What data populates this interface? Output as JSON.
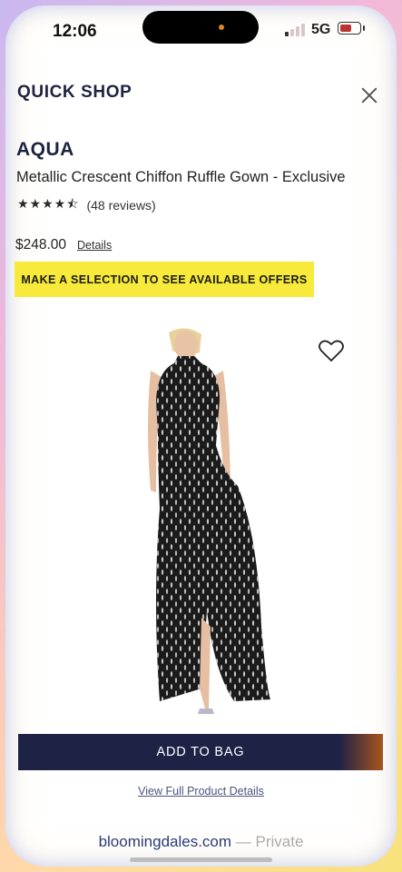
{
  "status_bar": {
    "time": "12:06",
    "network": "5G"
  },
  "header": {
    "title": "QUICK SHOP"
  },
  "product": {
    "brand": "AQUA",
    "name": "Metallic Crescent Chiffon Ruffle Gown - Exclusive",
    "rating": 4.5,
    "stars": "★★★★⯪",
    "reviews": "(48 reviews)",
    "price": "$248.00",
    "details_link": "Details"
  },
  "offer_banner": "MAKE A SELECTION TO SEE AVAILABLE OFFERS",
  "actions": {
    "add_to_bag": "ADD TO BAG",
    "view_full": "View Full Product Details"
  },
  "browser": {
    "domain": "bloomingdales.com",
    "private": "— Private"
  },
  "colors": {
    "navy": "#1e2245",
    "banner_yellow": "#f7ea3a",
    "brand_navy": "#1d2340"
  }
}
